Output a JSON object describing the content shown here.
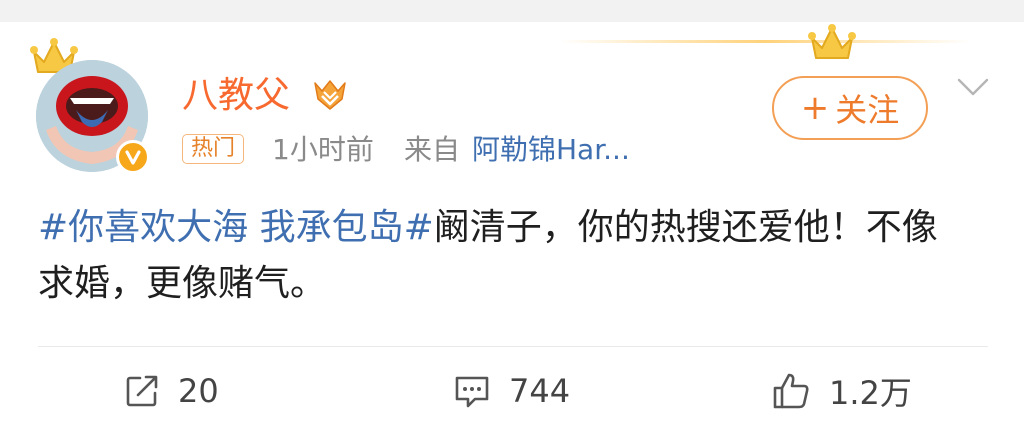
{
  "post": {
    "author": {
      "name": "八教父",
      "verified": true,
      "vip_badge": "vip-crown-badge",
      "tag": "热门"
    },
    "meta": {
      "time": "1小时前",
      "from_label": "来自",
      "source": "阿勒锦Har..."
    },
    "follow_button": {
      "plus": "+",
      "label": "关注"
    },
    "content": {
      "topic": "#你喜欢大海 我承包岛#",
      "text": "阚清子，你的热搜还爱他！不像求婚，更像赌气。"
    },
    "actions": {
      "repost_count": "20",
      "comment_count": "744",
      "like_count": "1.2万"
    }
  },
  "colors": {
    "username": "#f7692f",
    "link": "#3f6fb0",
    "follow": "#ee7a2c",
    "meta": "#8a8a8a"
  }
}
